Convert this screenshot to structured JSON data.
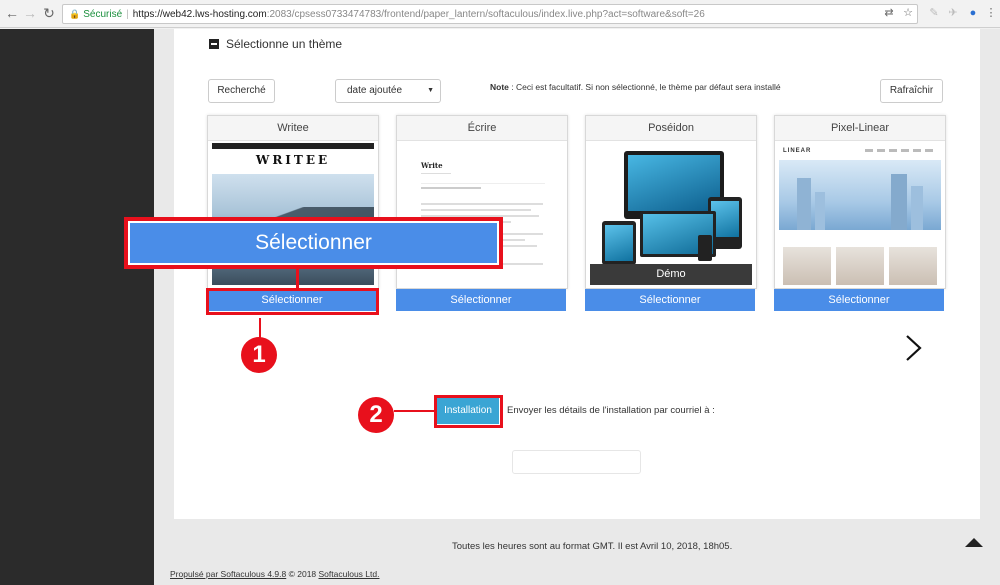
{
  "browser": {
    "secure_label": "Sécurisé",
    "url_host": "https://web42.lws-hosting.com",
    "url_rest": ":2083/cpsess0733474783/frontend/paper_lantern/softaculous/index.live.php?act=software&soft=26"
  },
  "section": {
    "title": "Sélectionne un thème"
  },
  "toolbar": {
    "search_label": "Recherché",
    "sort_value": "date ajoutée",
    "note_bold": "Note",
    "note_text": " : Ceci est facultatif. Si non sélectionné, le thème par défaut sera installé",
    "refresh_label": "Rafraîchir"
  },
  "themes": [
    {
      "name": "Writee",
      "select_label": "Sélectionner",
      "logo": "WRITEE"
    },
    {
      "name": "Écrire",
      "select_label": "Sélectionner",
      "logo": "Write"
    },
    {
      "name": "Poséidon",
      "select_label": "Sélectionner",
      "demo_label": "Démo"
    },
    {
      "name": "Pixel-Linear",
      "select_label": "Sélectionner",
      "logo": "LINEAR"
    }
  ],
  "callout": {
    "label": "Sélectionner"
  },
  "steps": [
    "1",
    "2"
  ],
  "install": {
    "button_label": "Installation",
    "email_text": "Envoyer les détails de l'installation par courriel à :"
  },
  "footer": {
    "time_text": "Toutes les heures sont au format GMT. Il est Avril 10, 2018, 18h05.",
    "powered_prefix": "Propulsé par Softaculous 4.9.8",
    "copyright_mid": " © 2018 ",
    "company": "Softaculous Ltd."
  },
  "colors": {
    "accent_blue": "#4a8de8",
    "install_blue": "#3aa5d4",
    "annotation_red": "#e8101c",
    "sidebar": "#2b2b2b"
  }
}
